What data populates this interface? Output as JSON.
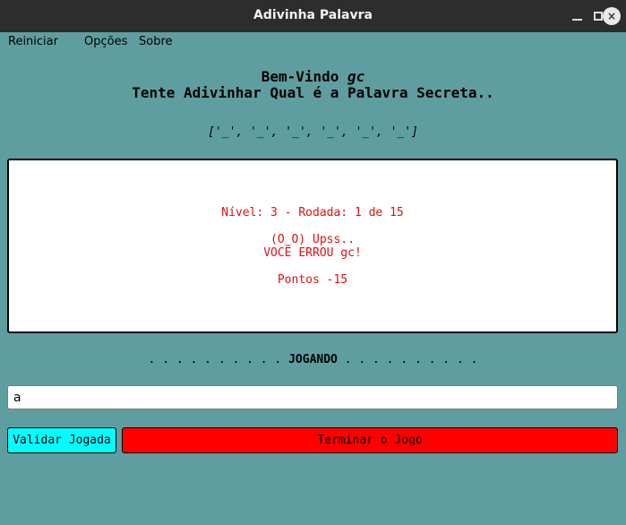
{
  "window": {
    "title": "Adivinha Palavra",
    "close_glyph": "×"
  },
  "menu": {
    "items": [
      "Reiniciar",
      "Opções",
      "Sobre"
    ]
  },
  "header": {
    "welcome_prefix": "Bem-Vindo ",
    "player_name": "gc",
    "subtitle": "Tente Adivinhar Qual é a Palavra Secreta.."
  },
  "secret_word": "['_', '_', '_', '_', '_', '_']",
  "panel": {
    "level_round": "Nível: 3 - Rodada: 1 de 15",
    "reaction": "(O_O) Upss..",
    "result": "VOCÊ ERROU gc!",
    "points": "Pontos -15"
  },
  "status": {
    "dots_left": ". . . . . . . . . . ",
    "label": "JOGANDO",
    "dots_right": " . . . . . . . . . ."
  },
  "guess_input": {
    "value": "a"
  },
  "buttons": {
    "validate": "Validar Jogada",
    "finish": "Terminar o Jogo"
  },
  "colors": {
    "background": "#5f9ea0",
    "message_text": "#e01010",
    "validate_button": "#00ffff",
    "finish_button": "#ff0000"
  },
  "icons": {
    "minimize": "minimize-icon",
    "maximize": "maximize-icon",
    "close": "close-icon"
  }
}
